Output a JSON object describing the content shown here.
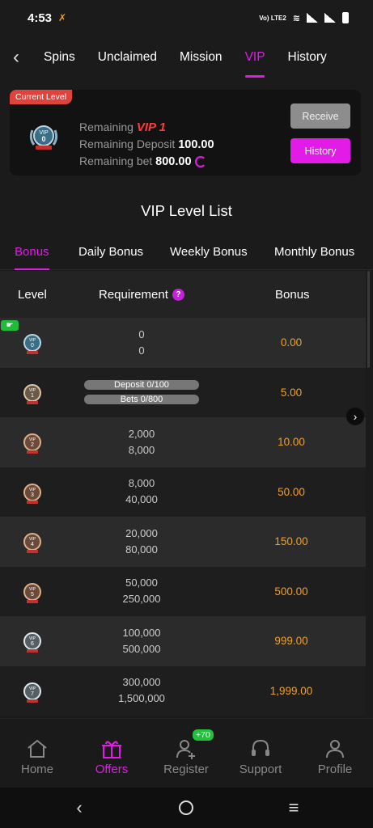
{
  "status_bar": {
    "time": "4:53",
    "network": "Vo) LTE2"
  },
  "nav": {
    "tabs": [
      {
        "label": "Spins"
      },
      {
        "label": "Unclaimed"
      },
      {
        "label": "Mission"
      },
      {
        "label": "VIP"
      },
      {
        "label": "History"
      }
    ],
    "active": "VIP"
  },
  "level_card": {
    "tag": "Current Level",
    "badge_vip": "VIP",
    "badge_level": "0",
    "remaining_label": "Remaining",
    "remaining_vip": "VIP 1",
    "deposit_label": "Remaining Deposit",
    "deposit_value": "100.00",
    "bet_label": "Remaining bet",
    "bet_value": "800.00",
    "receive_label": "Receive",
    "history_label": "History"
  },
  "section_title": "VIP Level List",
  "bonus_tabs": [
    {
      "label": "Bonus"
    },
    {
      "label": "Daily Bonus"
    },
    {
      "label": "Weekly Bonus"
    },
    {
      "label": "Monthly Bonus"
    }
  ],
  "table": {
    "headers": {
      "level": "Level",
      "requirement": "Requirement",
      "help": "?",
      "bonus": "Bonus"
    },
    "rows": [
      {
        "badge": "VIP",
        "level": "0",
        "req1": "0",
        "req2": "0",
        "bonus": "0.00"
      },
      {
        "badge": "VIP",
        "level": "1",
        "pill1": "Deposit 0/100",
        "pill2": "Bets 0/800",
        "bonus": "5.00"
      },
      {
        "badge": "VIP",
        "level": "2",
        "req1": "2,000",
        "req2": "8,000",
        "bonus": "10.00"
      },
      {
        "badge": "VIP",
        "level": "3",
        "req1": "8,000",
        "req2": "40,000",
        "bonus": "50.00"
      },
      {
        "badge": "VIP",
        "level": "4",
        "req1": "20,000",
        "req2": "80,000",
        "bonus": "150.00"
      },
      {
        "badge": "VIP",
        "level": "5",
        "req1": "50,000",
        "req2": "250,000",
        "bonus": "500.00"
      },
      {
        "badge": "VIP",
        "level": "6",
        "req1": "100,000",
        "req2": "500,000",
        "bonus": "999.00"
      },
      {
        "badge": "VIP",
        "level": "7",
        "req1": "300,000",
        "req2": "1,500,000",
        "bonus": "1,999.00"
      }
    ]
  },
  "bottom_nav": [
    {
      "label": "Home",
      "icon": "home-icon"
    },
    {
      "label": "Offers",
      "icon": "gift-icon"
    },
    {
      "label": "Register",
      "icon": "user-add-icon"
    },
    {
      "label": "Support",
      "icon": "headset-icon"
    },
    {
      "label": "Profile",
      "icon": "profile-icon"
    }
  ],
  "register_badge": "+70",
  "colors": {
    "accent": "#e21be8",
    "bonus": "#f0a02a",
    "tag": "#e0433c"
  }
}
